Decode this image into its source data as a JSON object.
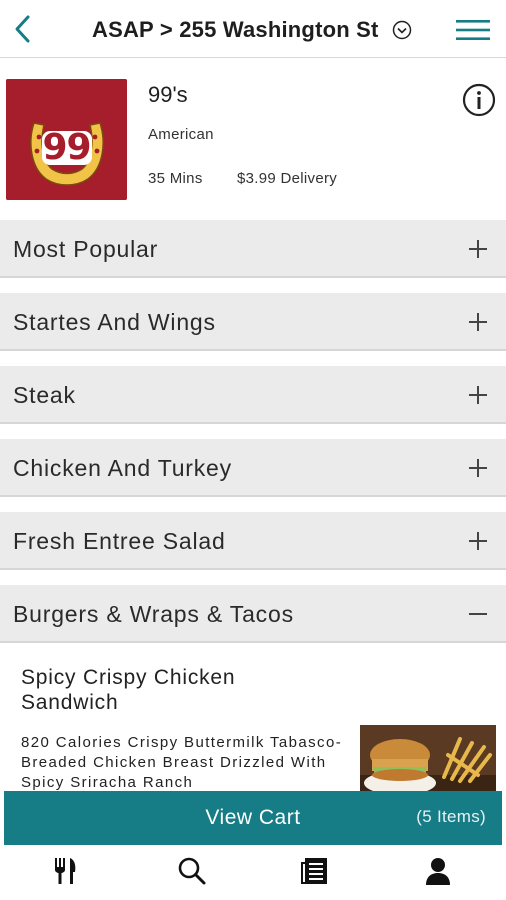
{
  "header": {
    "title": "ASAP > 255 Washington St",
    "back_icon": "chevron-left-icon",
    "dropdown_icon": "chevron-down-circle-icon",
    "menu_icon": "hamburger-menu-icon"
  },
  "restaurant": {
    "logo_text": "99",
    "name": "99's",
    "cuisine": "American",
    "time": "35 Mins",
    "delivery_fee": "$3.99 Delivery",
    "info_icon": "info-icon"
  },
  "categories": [
    {
      "label": "Most Popular",
      "expanded": false
    },
    {
      "label": "Startes And Wings",
      "expanded": false
    },
    {
      "label": "Steak",
      "expanded": false
    },
    {
      "label": "Chicken And Turkey",
      "expanded": false
    },
    {
      "label": "Fresh Entree Salad",
      "expanded": false
    },
    {
      "label": "Burgers & Wraps & Tacos",
      "expanded": true
    }
  ],
  "item": {
    "name": "Spicy Crispy Chicken Sandwich",
    "description": "820 Calories Crispy Buttermilk Tabasco-Breaded Chicken Breast Drizzled With Spicy Sriracha Ranch"
  },
  "cart": {
    "label": "View Cart",
    "count": "(5 Items)"
  },
  "bottom_nav": [
    {
      "icon": "fork-knife-icon"
    },
    {
      "icon": "search-icon"
    },
    {
      "icon": "orders-icon"
    },
    {
      "icon": "account-icon"
    }
  ],
  "colors": {
    "accent": "#167c85",
    "logo_bg": "#a61e2c",
    "category_bg": "#ebebeb"
  }
}
